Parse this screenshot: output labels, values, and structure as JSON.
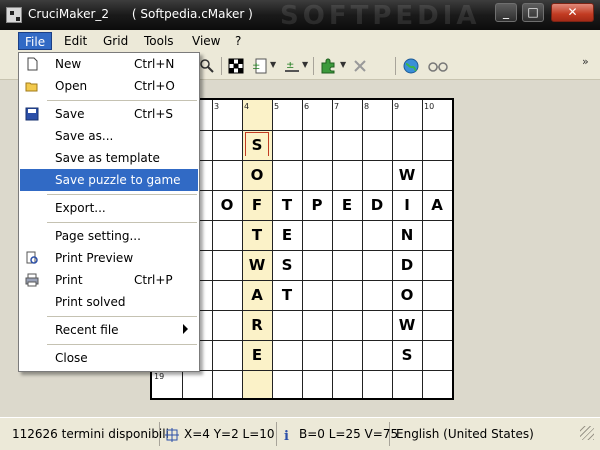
{
  "window": {
    "title": "CruciMaker_2      ( Softpedia.cMaker )",
    "watermark": "SOFTPEDIA",
    "controls": {
      "minimize": "_",
      "maximize": "□",
      "close": "✕"
    }
  },
  "menubar": {
    "items": [
      "File",
      "Edit",
      "Grid",
      "Tools",
      "View",
      "?"
    ]
  },
  "toolbar": {
    "icons": [
      "zoom-icon",
      "grid-pattern-icon",
      "insert-row-icon",
      "insert-col-icon",
      "puzzle-piece-icon",
      "delete-icon",
      "globe-icon",
      "glasses-icon"
    ],
    "overflow": "»"
  },
  "file_menu": {
    "items": [
      {
        "label": "New",
        "shortcut": "Ctrl+N",
        "icon": "new-document-icon"
      },
      {
        "label": "Open",
        "shortcut": "Ctrl+O",
        "icon": "open-folder-icon"
      },
      {
        "label": "Save",
        "shortcut": "Ctrl+S",
        "icon": "save-disk-icon"
      },
      {
        "label": "Save as...",
        "shortcut": ""
      },
      {
        "label": "Save as template",
        "shortcut": ""
      },
      {
        "label": "Save puzzle to game",
        "shortcut": "",
        "selected": true
      },
      {
        "label": "Export...",
        "shortcut": ""
      },
      {
        "label": "Page setting...",
        "shortcut": ""
      },
      {
        "label": "Print Preview",
        "shortcut": "",
        "icon": "print-preview-icon"
      },
      {
        "label": "Print",
        "shortcut": "Ctrl+P",
        "icon": "printer-icon"
      },
      {
        "label": "Print solved",
        "shortcut": ""
      },
      {
        "label": "Recent file",
        "shortcut": "",
        "submenu": true
      },
      {
        "label": "Close",
        "shortcut": ""
      }
    ]
  },
  "grid": {
    "col_numbers": [
      "3",
      "4",
      "5",
      "6",
      "7",
      "8",
      "9",
      "10"
    ],
    "row_numbers": [
      "19"
    ],
    "highlight_color": "#fbf2c8",
    "cursor_color": "#c23b22",
    "letters": [
      {
        "col": 3,
        "row": 1,
        "char": "S"
      },
      {
        "col": 3,
        "row": 2,
        "char": "O"
      },
      {
        "col": 8,
        "row": 2,
        "char": "W"
      },
      {
        "col": 2,
        "row": 3,
        "char": "O"
      },
      {
        "col": 3,
        "row": 3,
        "char": "F"
      },
      {
        "col": 4,
        "row": 3,
        "char": "T"
      },
      {
        "col": 5,
        "row": 3,
        "char": "P"
      },
      {
        "col": 6,
        "row": 3,
        "char": "E"
      },
      {
        "col": 7,
        "row": 3,
        "char": "D"
      },
      {
        "col": 8,
        "row": 3,
        "char": "I"
      },
      {
        "col": 9,
        "row": 3,
        "char": "A"
      },
      {
        "col": 3,
        "row": 4,
        "char": "T"
      },
      {
        "col": 4,
        "row": 4,
        "char": "E"
      },
      {
        "col": 8,
        "row": 4,
        "char": "N"
      },
      {
        "col": 3,
        "row": 5,
        "char": "W"
      },
      {
        "col": 4,
        "row": 5,
        "char": "S"
      },
      {
        "col": 8,
        "row": 5,
        "char": "D"
      },
      {
        "col": 3,
        "row": 6,
        "char": "A"
      },
      {
        "col": 4,
        "row": 6,
        "char": "T"
      },
      {
        "col": 8,
        "row": 6,
        "char": "O"
      },
      {
        "col": 3,
        "row": 7,
        "char": "R"
      },
      {
        "col": 8,
        "row": 7,
        "char": "W"
      },
      {
        "col": 3,
        "row": 8,
        "char": "E"
      },
      {
        "col": 8,
        "row": 8,
        "char": "S"
      }
    ],
    "watermark": "SOFTPEDIA",
    "watermark_url": "www.softpedia.com"
  },
  "statusbar": {
    "terms": "112626 termini disponibili",
    "position": "X=4  Y=2  L=10",
    "info": "B=0  L=25  V=75",
    "language": "English (United States)"
  }
}
